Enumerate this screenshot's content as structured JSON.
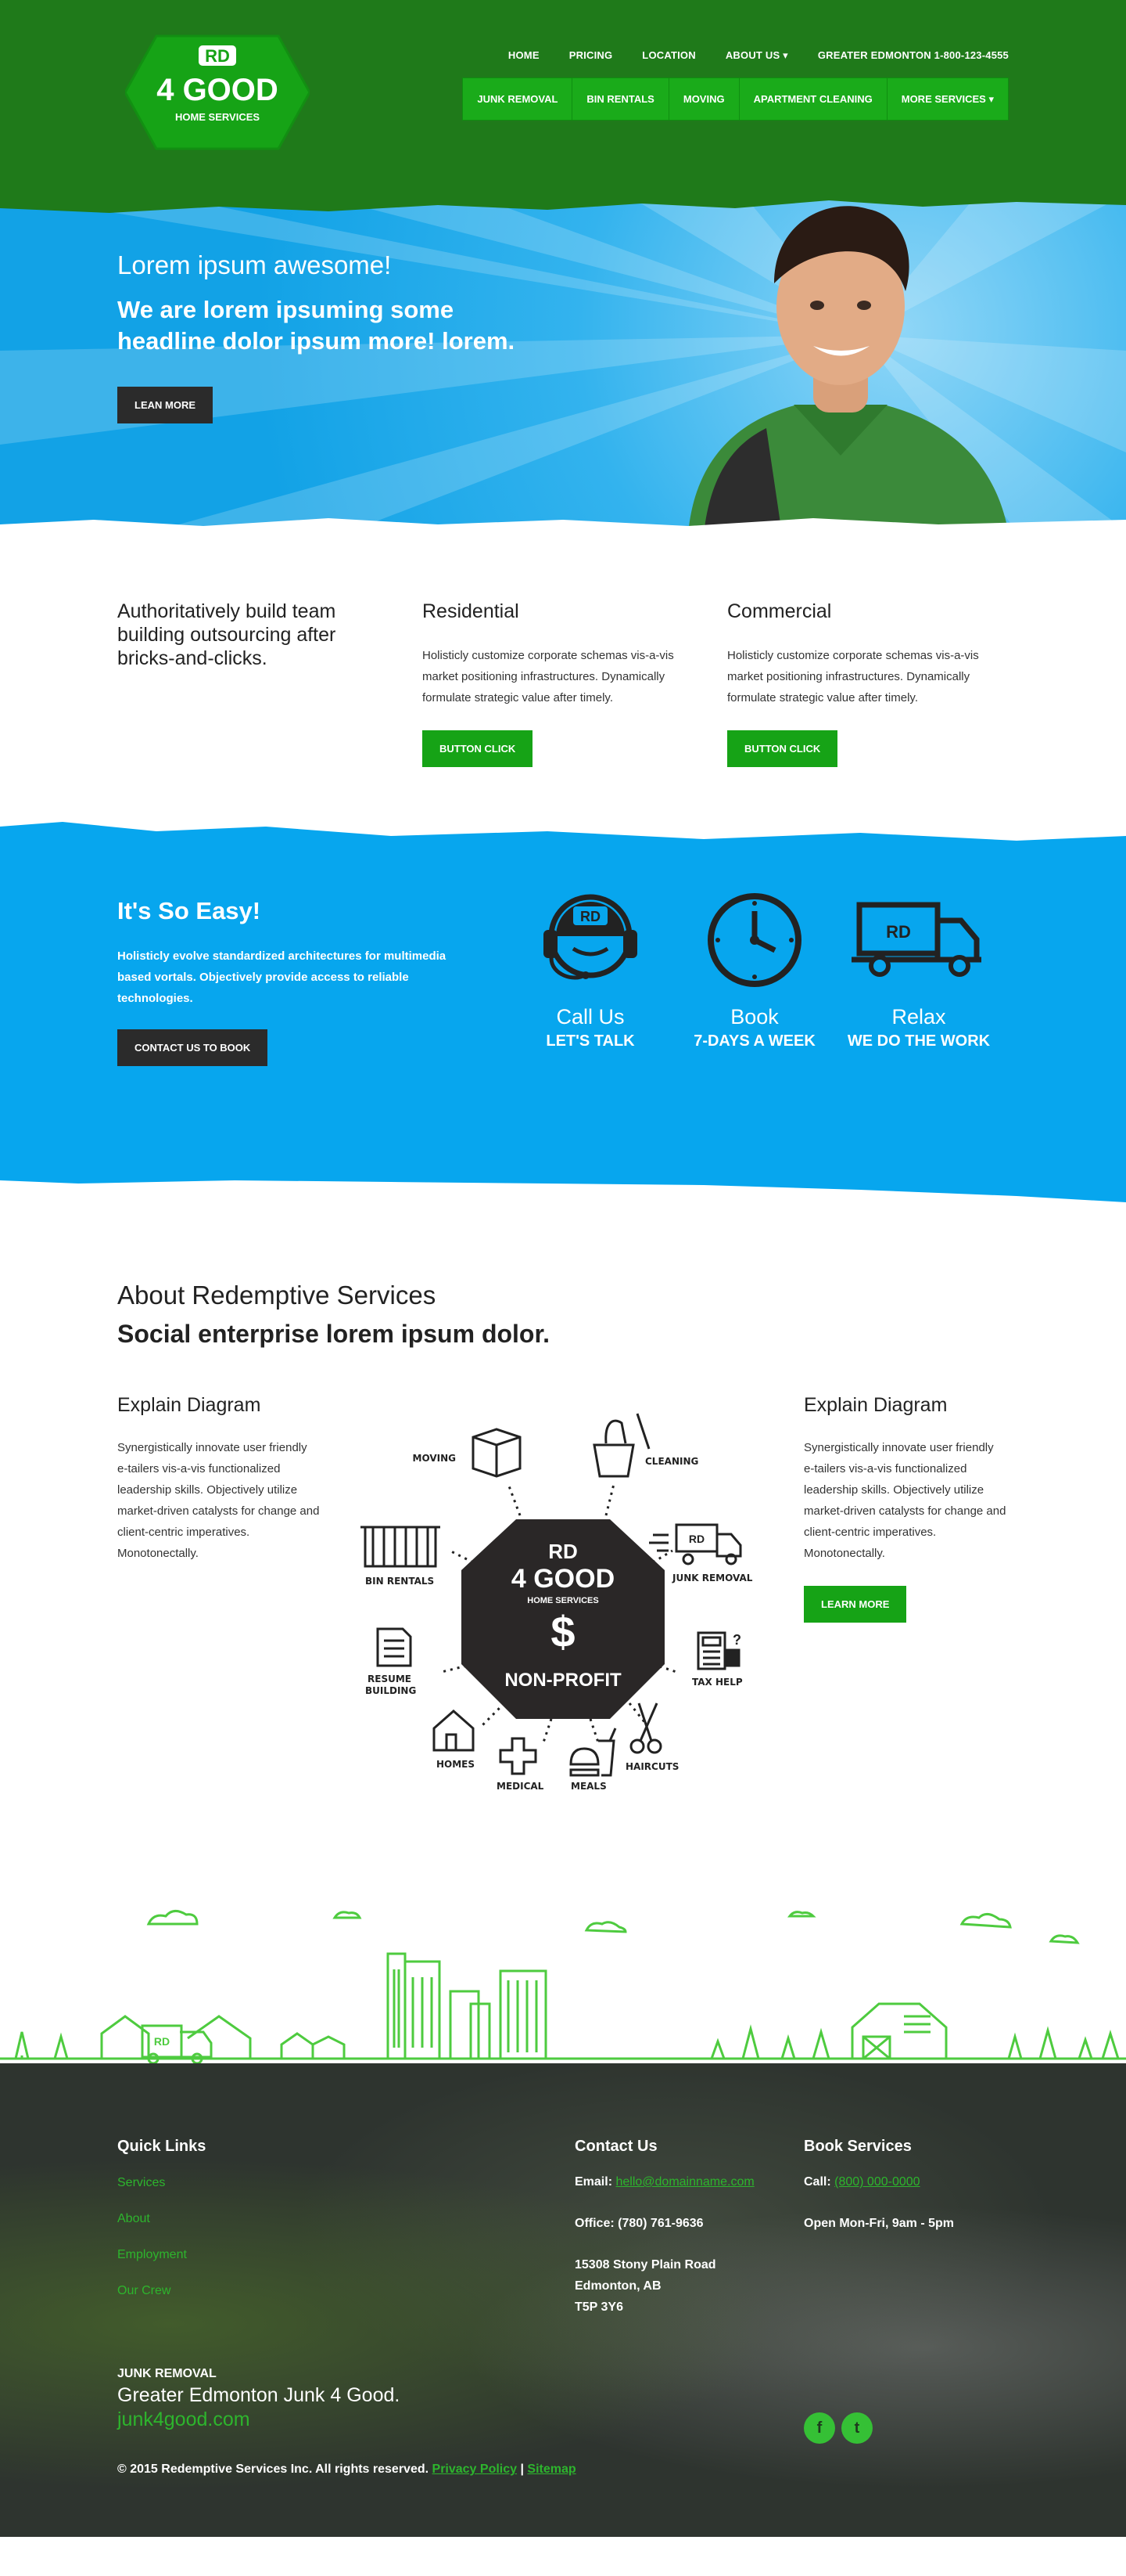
{
  "brand": {
    "mark": "RD",
    "name": "4 GOOD",
    "tagline": "HOME SERVICES"
  },
  "nav_top": [
    "HOME",
    "PRICING",
    "LOCATION",
    "ABOUT US ▾",
    "GREATER EDMONTON 1-800-123-4555"
  ],
  "nav_services": [
    "JUNK REMOVAL",
    "BIN RENTALS",
    "MOVING",
    "APARTMENT CLEANING",
    "MORE SERVICES ▾"
  ],
  "hero": {
    "kicker": "Lorem ipsum awesome!",
    "headline": "We are lorem ipsuming some headline dolor ipsum more! lorem.",
    "button": "LEAN MORE"
  },
  "intro": {
    "col1_title": "Authoritatively build team building outsourcing after bricks-and-clicks.",
    "residential_title": "Residential",
    "residential_text": "Holisticly customize corporate schemas vis-a-vis market positioning infrastructures. Dynamically formulate strategic value after timely.",
    "residential_button": "BUTTON CLICK",
    "commercial_title": "Commercial",
    "commercial_text": "Holisticly customize corporate schemas vis-a-vis market positioning infrastructures. Dynamically formulate strategic value after timely.",
    "commercial_button": "BUTTON CLICK"
  },
  "easy": {
    "title": "It's So Easy!",
    "text": "Holisticly evolve standardized architectures for multimedia based vortals. Objectively provide access to reliable technologies.",
    "button": "CONTACT US TO BOOK",
    "steps": [
      {
        "icon": "headset-agent-icon",
        "line1": "Call Us",
        "line2": "LET'S TALK"
      },
      {
        "icon": "clock-icon",
        "line1": "Book",
        "line2": "7-DAYS A WEEK"
      },
      {
        "icon": "truck-icon",
        "line1": "Relax",
        "line2": "WE DO THE WORK"
      }
    ]
  },
  "about": {
    "title": "About Redemptive Services",
    "subtitle": "Social enterprise lorem ipsum dolor.",
    "left_title": "Explain Diagram",
    "left_text": "Synergistically innovate user friendly e-tailers vis-a-vis functionalized leadership skills. Objectively utilize market-driven catalysts for change and client-centric imperatives. Monotonectally.",
    "right_title": "Explain Diagram",
    "right_text": "Synergistically innovate user friendly e-tailers vis-a-vis functionalized leadership skills. Objectively utilize market-driven catalysts for change and client-centric imperatives. Monotonectally.",
    "right_button": "LEARN MORE",
    "diagram": {
      "center_mark": "RD",
      "center_name": "4 GOOD",
      "center_tagline": "HOME SERVICES",
      "center_symbol": "$",
      "center_label": "NON-PROFIT",
      "items": {
        "moving": "MOVING",
        "cleaning": "CLEANING",
        "bin_rentals": "BIN RENTALS",
        "junk_removal": "JUNK REMOVAL",
        "resume_1": "RESUME",
        "resume_2": "BUILDING",
        "tax_help": "TAX HELP",
        "homes": "HOMES",
        "medical": "MEDICAL",
        "meals": "MEALS",
        "haircuts": "HAIRCUTS"
      }
    }
  },
  "footer": {
    "quick_links_title": "Quick Links",
    "quick_links": [
      "Services",
      "About",
      "Employment",
      "Our Crew"
    ],
    "contact_title": "Contact Us",
    "email_label": "Email: ",
    "email": "hello@domainname.com",
    "office": "Office: (780) 761-9636",
    "address_1": "15308 Stony Plain Road",
    "address_2": "Edmonton, AB",
    "address_3": "T5P 3Y6",
    "book_title": "Book Services",
    "call_label": "Call: ",
    "call": "(800) 000-0000",
    "hours": "Open Mon-Fri, 9am - 5pm",
    "brand_small": "JUNK REMOVAL",
    "brand_line": "Greater Edmonton Junk 4 Good.",
    "brand_url": "junk4good.com",
    "copyright": "© 2015 Redemptive Services Inc. All rights reserved.",
    "privacy": "Privacy Policy",
    "sep": "|",
    "sitemap": "Sitemap"
  },
  "colors": {
    "dark_green": "#1f7a1a",
    "green": "#16a316",
    "blue": "#07a6ee",
    "dark": "#2b2b2b"
  }
}
